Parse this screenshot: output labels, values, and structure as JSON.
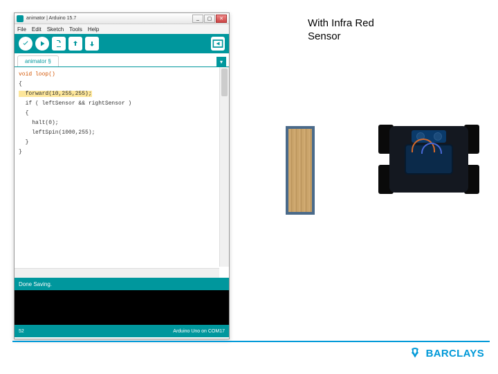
{
  "ide": {
    "titlebar": {
      "text": "animator | Arduino 15.7"
    },
    "win_controls": {
      "min": "_",
      "max": "▢",
      "close": "✕"
    },
    "menu": {
      "file": "File",
      "edit": "Edit",
      "sketch": "Sketch",
      "tools": "Tools",
      "help": "Help"
    },
    "tab": {
      "name": "animator §",
      "dropdown": "▾"
    },
    "code": {
      "l1": "void loop()",
      "l2": "",
      "l3": "{",
      "l4_hl": "  forward(10,255,255);",
      "l5": "",
      "l6": "  if ( leftSensor && rightSensor )",
      "l7": "  {",
      "l8": "    halt(0);",
      "l9": "    leftSpin(1000,255);",
      "l10": "  }",
      "l11": "}"
    },
    "status": "Done Saving.",
    "footer_left": "52",
    "footer_right": "Arduino Uno on COM17"
  },
  "caption": {
    "line1": "With Infra Red",
    "line2": "Sensor"
  },
  "brand": {
    "name": "BARCLAYS"
  },
  "colors": {
    "teal": "#00979d",
    "blue": "#0099d8"
  }
}
